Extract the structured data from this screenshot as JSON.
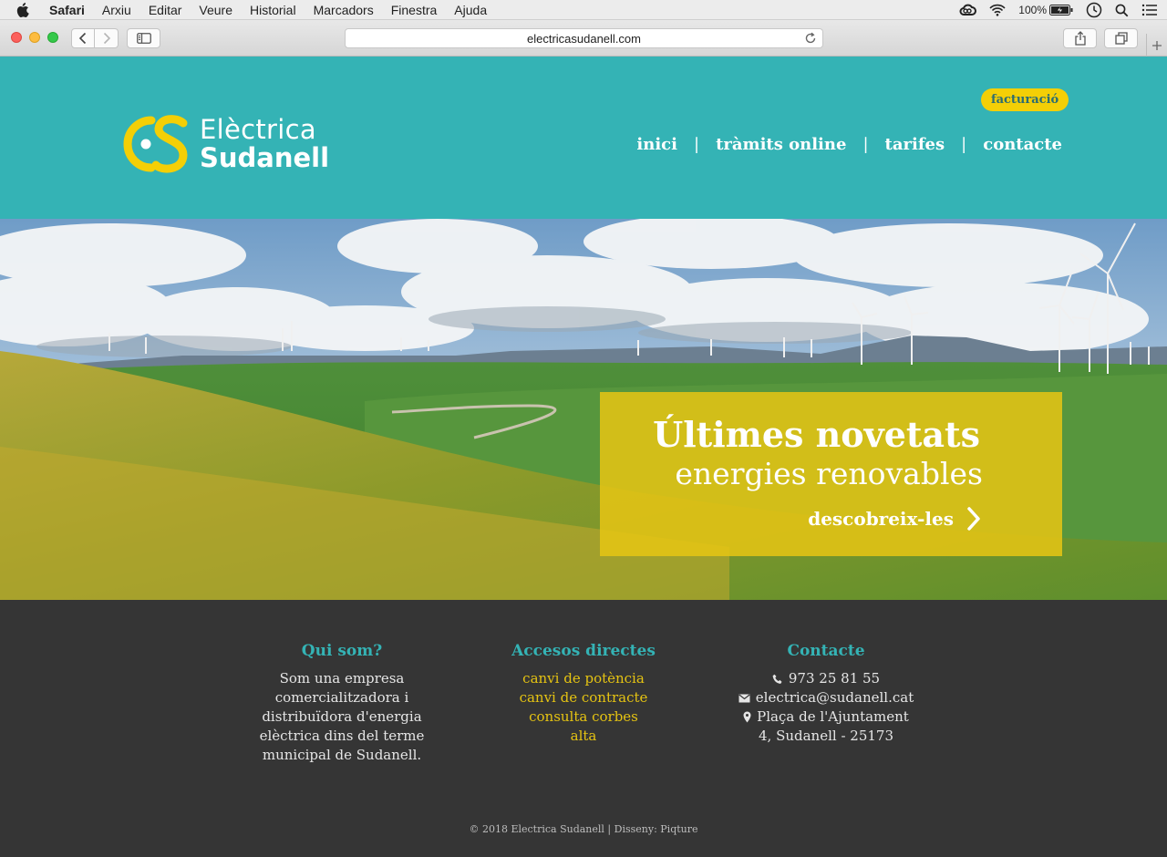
{
  "menubar": {
    "app": "Safari",
    "items": [
      "Arxiu",
      "Editar",
      "Veure",
      "Historial",
      "Marcadors",
      "Finestra",
      "Ajuda"
    ],
    "battery": "100%"
  },
  "browser": {
    "url": "electricasudanell.com"
  },
  "site": {
    "logo_line1": "Elèctrica",
    "logo_line2": "Sudanell",
    "billing_label": "facturació",
    "nav": [
      "inici",
      "tràmits online",
      "tarifes",
      "contacte"
    ],
    "nav_separator": "|"
  },
  "hero": {
    "title": "Últimes novetats",
    "subtitle": "energies renovables",
    "link": "descobreix-les"
  },
  "footer": {
    "about": {
      "heading": "Qui som?",
      "text": "Som una empresa comercialitzadora i distribuïdora d'energia elèctrica dins del terme municipal de Sudanell."
    },
    "links": {
      "heading": "Accesos directes",
      "items": [
        "canvi de potència",
        "canvi de contracte",
        "consulta corbes",
        "alta"
      ]
    },
    "contact": {
      "heading": "Contacte",
      "phone": "973 25 81 55",
      "email": "electrica@sudanell.cat",
      "address_line1": "Plaça de l'Ajuntament",
      "address_line2": "4, Sudanell - 25173"
    },
    "copyright": "© 2018 Electrica Sudanell | Disseny: Piqture"
  },
  "colors": {
    "brand_teal": "#34b3b5",
    "brand_yellow": "#f4cf06",
    "footer_bg": "#353535"
  }
}
